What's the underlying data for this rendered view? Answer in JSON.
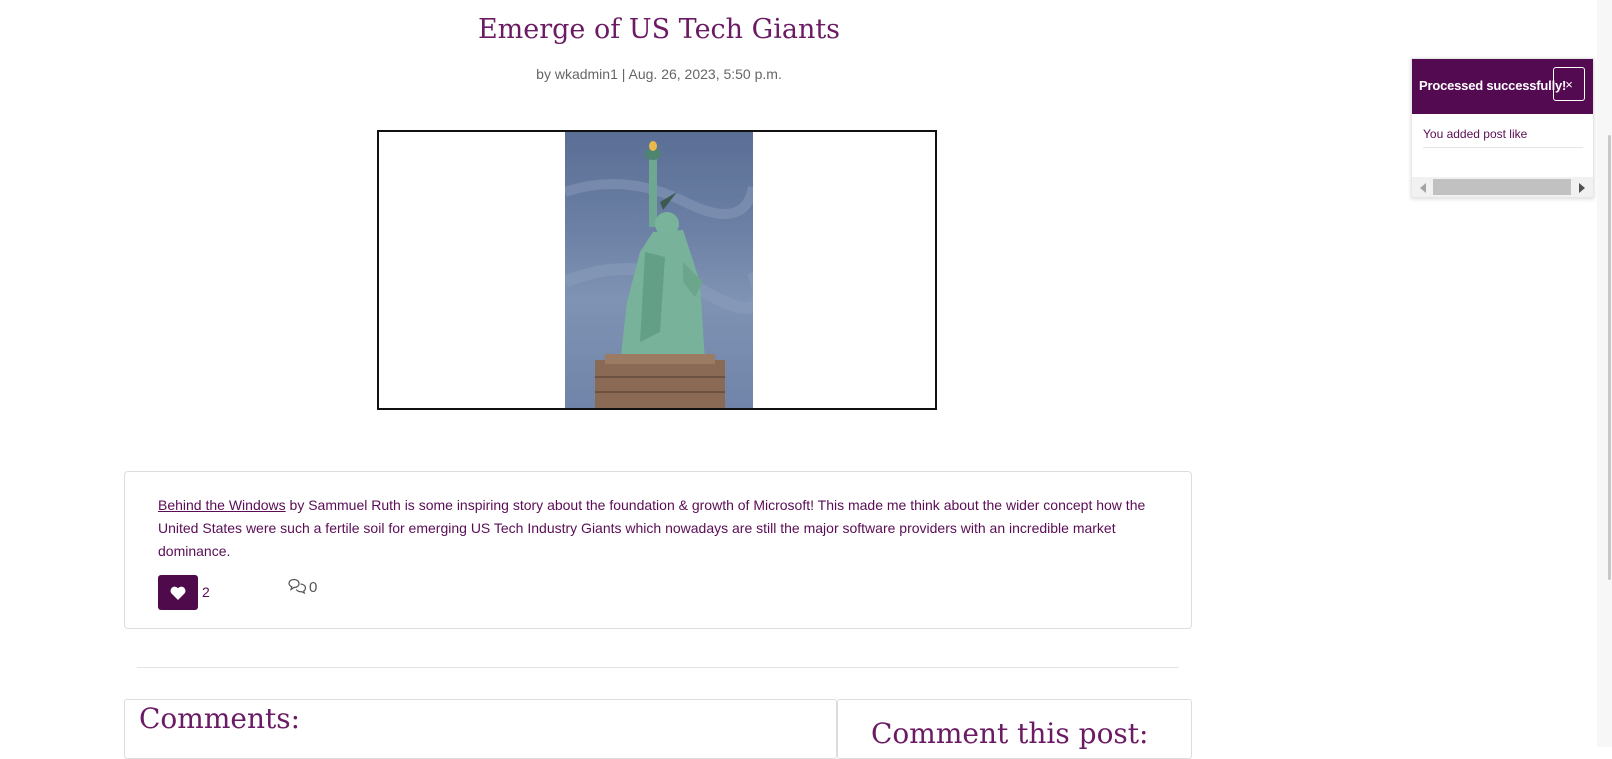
{
  "post": {
    "title": "Emerge of US Tech Giants",
    "meta": "by wkadmin1 | Aug. 26, 2023, 5:50 p.m.",
    "link_text": "Behind the Windows",
    "body": " by Sammuel Ruth is some inspiring story about the foundation & growth of Microsoft! This made me think about the wider concept how the United States were such a fertile soil for emerging US Tech Industry Giants which nowadays are still the major software providers with an incredible market dominance.",
    "likes": "2",
    "comments_count": "0"
  },
  "comments": {
    "title": "Comments:",
    "form_title": "Comment this post:"
  },
  "toast": {
    "title": "Processed successfully!",
    "close": "×",
    "message": "You added post like"
  },
  "icons": {
    "like": "heart-icon",
    "comments": "chat-bubbles-icon",
    "close": "close-icon"
  },
  "colors": {
    "brand": "#540a51",
    "title": "#6b1a64"
  }
}
